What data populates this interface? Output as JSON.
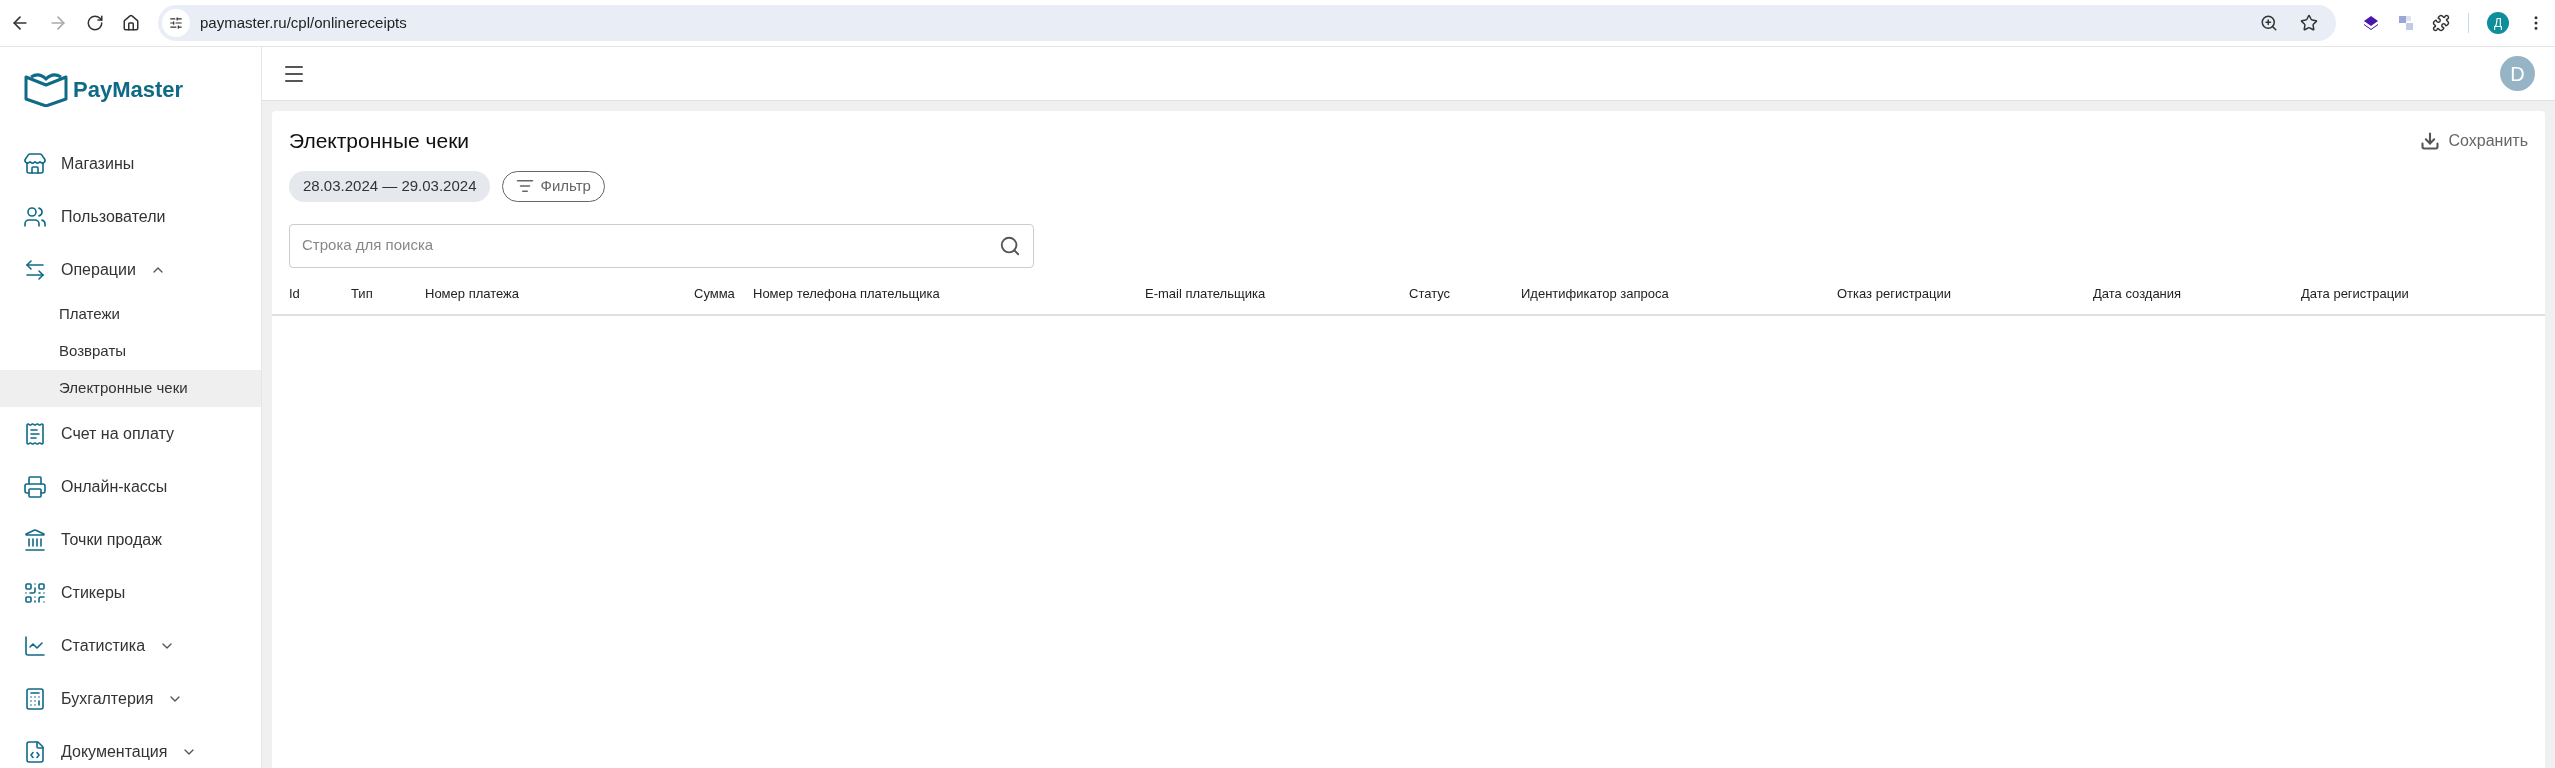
{
  "browser": {
    "url": "paymaster.ru/cpl/onlinereceipts",
    "forward_disabled": true,
    "profile_initial": "Д"
  },
  "sidebar": {
    "logo": "PayMaster",
    "items": [
      {
        "kind": "item",
        "label": "Магазины",
        "selected": false
      },
      {
        "kind": "item",
        "label": "Пользователи",
        "selected": false
      },
      {
        "kind": "group",
        "label": "Операции",
        "expanded": true,
        "selected": false
      },
      {
        "kind": "sub",
        "label": "Платежи",
        "selected": false
      },
      {
        "kind": "sub",
        "label": "Возвраты",
        "selected": false
      },
      {
        "kind": "sub",
        "label": "Электронные чеки",
        "selected": true
      },
      {
        "kind": "item",
        "label": "Счет на оплату",
        "selected": false
      },
      {
        "kind": "item",
        "label": "Онлайн-кассы",
        "selected": false
      },
      {
        "kind": "item",
        "label": "Точки продаж",
        "selected": false
      },
      {
        "kind": "item",
        "label": "Стикеры",
        "selected": false
      },
      {
        "kind": "group",
        "label": "Статистика",
        "expanded": false,
        "selected": false
      },
      {
        "kind": "group",
        "label": "Бухгалтерия",
        "expanded": false,
        "selected": false
      },
      {
        "kind": "group",
        "label": "Документация",
        "expanded": false,
        "selected": false
      }
    ]
  },
  "header": {
    "avatar": "D"
  },
  "page": {
    "title": "Электронные чеки",
    "save_button": "Сохранить",
    "date_range": "28.03.2024 — 29.03.2024",
    "filter_button": "Фильтр",
    "search": {
      "placeholder": "Строка для поиска"
    }
  },
  "table": {
    "columns": [
      "Id",
      "Тип",
      "Номер платежа",
      "Сумма",
      "Номер телефона плательщика",
      "E-mail плательщика",
      "Статус",
      "Идентификатор запроса",
      "Отказ регистрации",
      "Дата создания",
      "Дата регистрации"
    ]
  }
}
